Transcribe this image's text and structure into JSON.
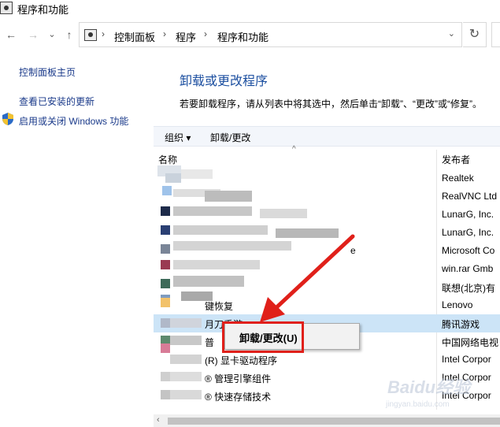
{
  "window": {
    "title": "程序和功能"
  },
  "nav": {
    "back_icon": "←",
    "forward_icon": "→",
    "history_icon": "⌄",
    "up_icon": "↑",
    "breadcrumbs": [
      "控制面板",
      "程序",
      "程序和功能"
    ],
    "sep": "›",
    "dropdown_icon": "⌄",
    "refresh_icon": "↻"
  },
  "sidebar": {
    "items": [
      {
        "label": "控制面板主页"
      },
      {
        "label": "查看已安装的更新"
      },
      {
        "label": "启用或关闭 Windows 功能"
      }
    ]
  },
  "main": {
    "heading": "卸载或更改程序",
    "description": "若要卸载程序，请从列表中将其选中，然后单击“卸载”、“更改”或“修复”。"
  },
  "toolbar": {
    "organize_label": "组织 ▾",
    "uninstall_label": "卸载/更改"
  },
  "columns": {
    "name": "名称",
    "publisher": "发布者",
    "sort_icon": "^"
  },
  "rows": [
    {
      "name": "",
      "publisher": "Realtek"
    },
    {
      "name": "",
      "publisher": "RealVNC Ltd"
    },
    {
      "name": "",
      "publisher": "LunarG, Inc."
    },
    {
      "name": "",
      "publisher": "LunarG, Inc."
    },
    {
      "name": "e",
      "publisher": "Microsoft Co"
    },
    {
      "name": "",
      "publisher": "win.rar Gmb"
    },
    {
      "name": "",
      "publisher": "联想(北京)有"
    },
    {
      "name": "键恢复",
      "publisher": "Lenovo"
    },
    {
      "name": "月刀手游",
      "publisher": "腾讯游戏"
    },
    {
      "name": "普",
      "publisher": "中国网络电视"
    },
    {
      "name": "(R) 显卡驱动程序",
      "publisher": "Intel Corpor"
    },
    {
      "name": "® 管理引擎组件",
      "publisher": "Intel Corpor"
    },
    {
      "name": "® 快速存储技术",
      "publisher": "Intel Corpor"
    }
  ],
  "context_menu": {
    "item_label": "卸载/更改(U)"
  },
  "scrollbar": {
    "left_icon": "‹"
  },
  "watermark": {
    "text": "Baidu经验",
    "sub": "jingyan.baidu.com"
  },
  "colors": {
    "accent": "#1c4fa0",
    "highlight_border": "#e0201a",
    "selected_row": "#cce4f7"
  }
}
